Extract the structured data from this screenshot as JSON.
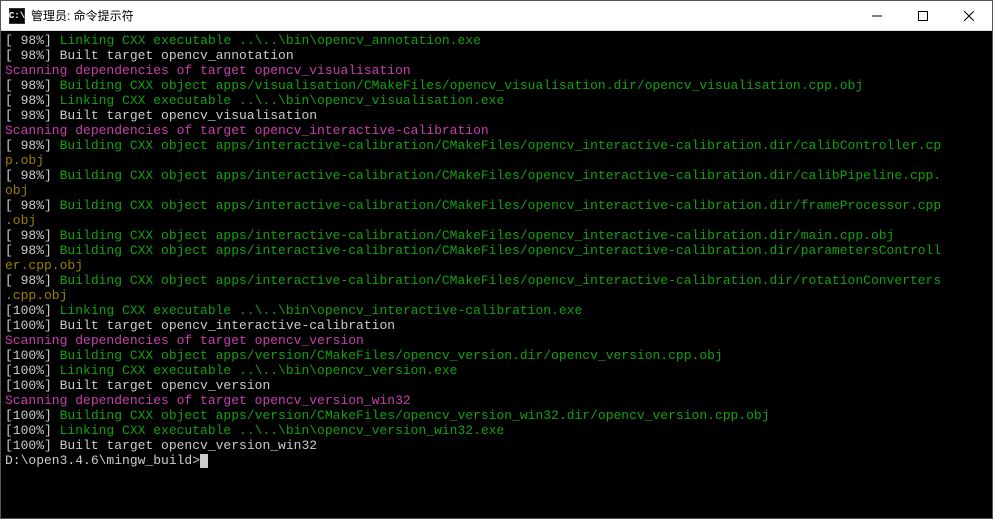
{
  "window": {
    "title": "管理员: 命令提示符",
    "icon_text": "C:\\"
  },
  "lines": [
    {
      "segments": [
        {
          "cls": "white",
          "t": "["
        },
        {
          "cls": "white",
          "t": " 98%"
        },
        {
          "cls": "white",
          "t": "] "
        },
        {
          "cls": "green",
          "t": "Linking CXX executable ..\\..\\bin\\opencv_annotation.exe"
        }
      ]
    },
    {
      "segments": [
        {
          "cls": "white",
          "t": "[ 98%] Built target opencv_annotation"
        }
      ]
    },
    {
      "segments": [
        {
          "cls": "magenta",
          "t": "Scanning dependencies of target opencv_visualisation"
        }
      ]
    },
    {
      "segments": [
        {
          "cls": "white",
          "t": "[ 98%] "
        },
        {
          "cls": "green",
          "t": "Building CXX object apps/visualisation/CMakeFiles/opencv_visualisation.dir/opencv_visualisation.cpp.obj"
        }
      ]
    },
    {
      "segments": [
        {
          "cls": "white",
          "t": "[ 98%] "
        },
        {
          "cls": "green",
          "t": "Linking CXX executable ..\\..\\bin\\opencv_visualisation.exe"
        }
      ]
    },
    {
      "segments": [
        {
          "cls": "white",
          "t": "[ 98%] Built target opencv_visualisation"
        }
      ]
    },
    {
      "segments": [
        {
          "cls": "magenta",
          "t": "Scanning dependencies of target opencv_interactive-calibration"
        }
      ]
    },
    {
      "segments": [
        {
          "cls": "white",
          "t": "[ 98%] "
        },
        {
          "cls": "green",
          "t": "Building CXX object apps/interactive-calibration/CMakeFiles/opencv_interactive-calibration.dir/calibController.cp"
        }
      ]
    },
    {
      "segments": [
        {
          "cls": "olive",
          "t": "p.obj"
        }
      ]
    },
    {
      "segments": [
        {
          "cls": "white",
          "t": "[ 98%] "
        },
        {
          "cls": "green",
          "t": "Building CXX object apps/interactive-calibration/CMakeFiles/opencv_interactive-calibration.dir/calibPipeline.cpp."
        }
      ]
    },
    {
      "segments": [
        {
          "cls": "olive",
          "t": "obj"
        }
      ]
    },
    {
      "segments": [
        {
          "cls": "white",
          "t": "[ 98%] "
        },
        {
          "cls": "green",
          "t": "Building CXX object apps/interactive-calibration/CMakeFiles/opencv_interactive-calibration.dir/frameProcessor.cpp"
        }
      ]
    },
    {
      "segments": [
        {
          "cls": "olive",
          "t": ".obj"
        }
      ]
    },
    {
      "segments": [
        {
          "cls": "white",
          "t": "[ 98%] "
        },
        {
          "cls": "green",
          "t": "Building CXX object apps/interactive-calibration/CMakeFiles/opencv_interactive-calibration.dir/main.cpp.obj"
        }
      ]
    },
    {
      "segments": [
        {
          "cls": "white",
          "t": "[ 98%] "
        },
        {
          "cls": "green",
          "t": "Building CXX object apps/interactive-calibration/CMakeFiles/opencv_interactive-calibration.dir/parametersControll"
        }
      ]
    },
    {
      "segments": [
        {
          "cls": "olive",
          "t": "er.cpp.obj"
        }
      ]
    },
    {
      "segments": [
        {
          "cls": "white",
          "t": "[ 98%] "
        },
        {
          "cls": "green",
          "t": "Building CXX object apps/interactive-calibration/CMakeFiles/opencv_interactive-calibration.dir/rotationConverters"
        }
      ]
    },
    {
      "segments": [
        {
          "cls": "olive",
          "t": ".cpp.obj"
        }
      ]
    },
    {
      "segments": [
        {
          "cls": "white",
          "t": "[100%] "
        },
        {
          "cls": "green",
          "t": "Linking CXX executable ..\\..\\bin\\opencv_interactive-calibration.exe"
        }
      ]
    },
    {
      "segments": [
        {
          "cls": "white",
          "t": "[100%] Built target opencv_interactive-calibration"
        }
      ]
    },
    {
      "segments": [
        {
          "cls": "magenta",
          "t": "Scanning dependencies of target opencv_version"
        }
      ]
    },
    {
      "segments": [
        {
          "cls": "white",
          "t": "[100%] "
        },
        {
          "cls": "green",
          "t": "Building CXX object apps/version/CMakeFiles/opencv_version.dir/opencv_version.cpp.obj"
        }
      ]
    },
    {
      "segments": [
        {
          "cls": "white",
          "t": "[100%] "
        },
        {
          "cls": "green",
          "t": "Linking CXX executable ..\\..\\bin\\opencv_version.exe"
        }
      ]
    },
    {
      "segments": [
        {
          "cls": "white",
          "t": "[100%] Built target opencv_version"
        }
      ]
    },
    {
      "segments": [
        {
          "cls": "magenta",
          "t": "Scanning dependencies of target opencv_version_win32"
        }
      ]
    },
    {
      "segments": [
        {
          "cls": "white",
          "t": "[100%] "
        },
        {
          "cls": "green",
          "t": "Building CXX object apps/version/CMakeFiles/opencv_version_win32.dir/opencv_version.cpp.obj"
        }
      ]
    },
    {
      "segments": [
        {
          "cls": "white",
          "t": "[100%] "
        },
        {
          "cls": "green",
          "t": "Linking CXX executable ..\\..\\bin\\opencv_version_win32.exe"
        }
      ]
    },
    {
      "segments": [
        {
          "cls": "white",
          "t": "[100%] Built target opencv_version_win32"
        }
      ]
    },
    {
      "segments": [
        {
          "cls": "white",
          "t": ""
        }
      ]
    }
  ],
  "prompt": {
    "path": "D:\\open3.4.6\\mingw_build>"
  }
}
